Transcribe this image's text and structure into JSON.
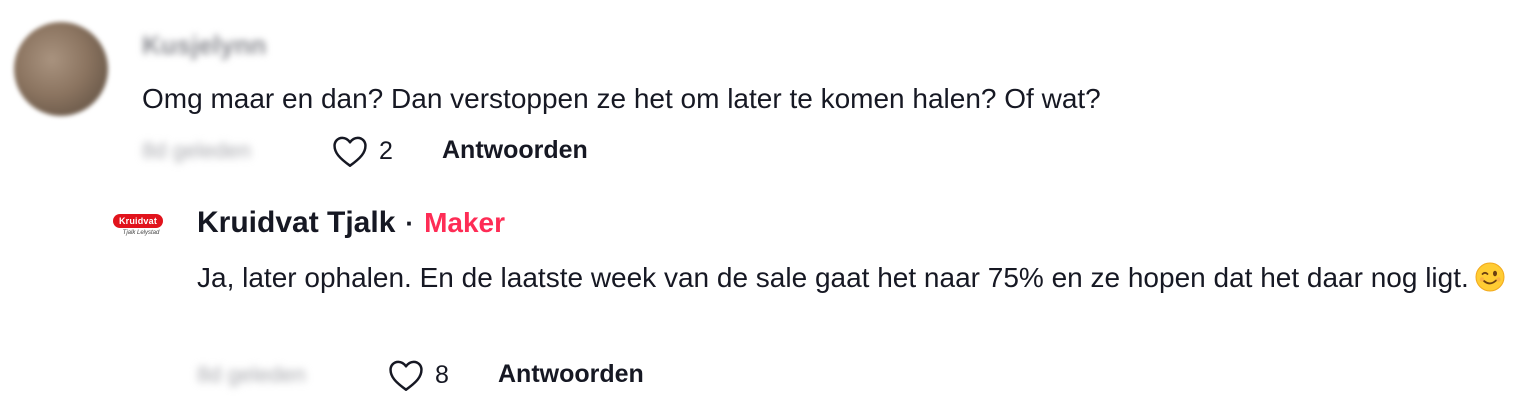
{
  "comment": {
    "username": "Kusjelynn",
    "text": "Omg maar en dan? Dan verstoppen ze het om later te komen halen? Of wat?",
    "time": "8d geleden",
    "likes": "2",
    "reply_label": "Antwoorden"
  },
  "reply": {
    "logo_text": "Kruidvat",
    "logo_sub": "Tjalk Lelystad",
    "author": "Kruidvat Tjalk",
    "separator": "·",
    "badge": "Maker",
    "text": "Ja, later ophalen. En de laatste week van de sale gaat het naar 75% en ze hopen dat het daar nog ligt.",
    "time": "8d geleden",
    "likes": "8",
    "reply_label": "Antwoorden"
  },
  "colors": {
    "maker_badge": "#fe2c55",
    "brand_red": "#e1131c",
    "text": "#161823"
  }
}
